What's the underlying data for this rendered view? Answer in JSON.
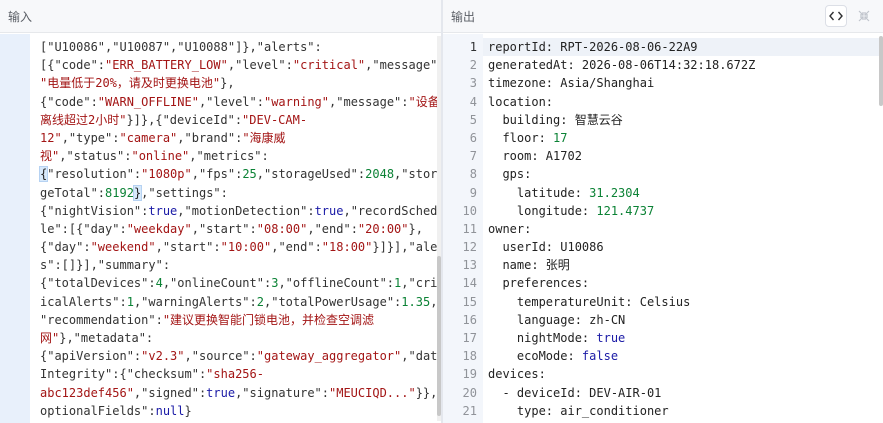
{
  "input_pane": {
    "title": "输入",
    "lines": [
      [
        [
          "p",
          "[\"U10086\",\"U10087\",\"U10088\"]},\"alerts\":"
        ]
      ],
      [
        [
          "p",
          "[{\"code\":"
        ],
        [
          "s",
          "\"ERR_BATTERY_LOW\""
        ],
        [
          "p",
          ",\"level\":"
        ],
        [
          "s",
          "\"critical\""
        ],
        [
          "p",
          ",\"message\":"
        ]
      ],
      [
        [
          "s",
          "\"电量低于20%，请及时更换电池\""
        ],
        [
          "p",
          "},"
        ]
      ],
      [
        [
          "p",
          "{\"code\":"
        ],
        [
          "s",
          "\"WARN_OFFLINE\""
        ],
        [
          "p",
          ",\"level\":"
        ],
        [
          "s",
          "\"warning\""
        ],
        [
          "p",
          ",\"message\":"
        ],
        [
          "s",
          "\"设备"
        ]
      ],
      [
        [
          "s",
          "离线超过2小时\""
        ],
        [
          "p",
          "}]},{\"deviceId\":"
        ],
        [
          "s",
          "\"DEV-CAM-"
        ]
      ],
      [
        [
          "s",
          "12\""
        ],
        [
          "p",
          ",\"type\":"
        ],
        [
          "s",
          "\"camera\""
        ],
        [
          "p",
          ",\"brand\":"
        ],
        [
          "s",
          "\"海康威"
        ]
      ],
      [
        [
          "s",
          "视\""
        ],
        [
          "p",
          ",\"status\":"
        ],
        [
          "s",
          "\"online\""
        ],
        [
          "p",
          ",\"metrics\":"
        ]
      ],
      [
        [
          "br",
          "{"
        ],
        [
          "p",
          "\"resolution\":"
        ],
        [
          "s",
          "\"1080p\""
        ],
        [
          "p",
          ",\"fps\":"
        ],
        [
          "n",
          "25"
        ],
        [
          "p",
          ",\"storageUsed\":"
        ],
        [
          "n",
          "2048"
        ],
        [
          "p",
          ",\"stora"
        ]
      ],
      [
        [
          "p",
          "geTotal\":"
        ],
        [
          "n",
          "8192"
        ],
        [
          "br",
          "}"
        ],
        [
          "p",
          ",\"settings\":"
        ]
      ],
      [
        [
          "p",
          "{\"nightVision\":"
        ],
        [
          "b",
          "true"
        ],
        [
          "p",
          ",\"motionDetection\":"
        ],
        [
          "b",
          "true"
        ],
        [
          "p",
          ",\"recordSchedu"
        ]
      ],
      [
        [
          "p",
          "le\":[{\"day\":"
        ],
        [
          "s",
          "\"weekday\""
        ],
        [
          "p",
          ",\"start\":"
        ],
        [
          "s",
          "\"08:00\""
        ],
        [
          "p",
          ",\"end\":"
        ],
        [
          "s",
          "\"20:00\""
        ],
        [
          "p",
          "},"
        ]
      ],
      [
        [
          "p",
          "{\"day\":"
        ],
        [
          "s",
          "\"weekend\""
        ],
        [
          "p",
          ",\"start\":"
        ],
        [
          "s",
          "\"10:00\""
        ],
        [
          "p",
          ",\"end\":"
        ],
        [
          "s",
          "\"18:00\""
        ],
        [
          "p",
          "}]}],\"alert"
        ]
      ],
      [
        [
          "p",
          "s\":[]}],\"summary\":"
        ]
      ],
      [
        [
          "p",
          "{\"totalDevices\":"
        ],
        [
          "n",
          "4"
        ],
        [
          "p",
          ",\"onlineCount\":"
        ],
        [
          "n",
          "3"
        ],
        [
          "p",
          ",\"offlineCount\":"
        ],
        [
          "n",
          "1"
        ],
        [
          "p",
          ",\"crit"
        ]
      ],
      [
        [
          "p",
          "icalAlerts\":"
        ],
        [
          "n",
          "1"
        ],
        [
          "p",
          ",\"warningAlerts\":"
        ],
        [
          "n",
          "2"
        ],
        [
          "p",
          ",\"totalPowerUsage\":"
        ],
        [
          "n",
          "1.35"
        ],
        [
          "p",
          ","
        ]
      ],
      [
        [
          "p",
          "\"recommendation\":"
        ],
        [
          "s",
          "\"建议更换智能门锁电池，并检查空调滤"
        ]
      ],
      [
        [
          "s",
          "网\""
        ],
        [
          "p",
          "},\"metadata\":"
        ]
      ],
      [
        [
          "p",
          "{\"apiVersion\":"
        ],
        [
          "s",
          "\"v2.3\""
        ],
        [
          "p",
          ",\"source\":"
        ],
        [
          "s",
          "\"gateway_aggregator\""
        ],
        [
          "p",
          ",\"data"
        ]
      ],
      [
        [
          "p",
          "Integrity\":{\"checksum\":"
        ],
        [
          "s",
          "\"sha256-"
        ]
      ],
      [
        [
          "s",
          "abc123def456\""
        ],
        [
          "p",
          ",\"signed\":"
        ],
        [
          "b",
          "true"
        ],
        [
          "p",
          ",\"signature\":"
        ],
        [
          "s",
          "\"MEUCIQD...\""
        ],
        [
          "p",
          "}},\""
        ]
      ],
      [
        [
          "p",
          "optionalFields\":"
        ],
        [
          "b",
          "null"
        ],
        [
          "p",
          "}"
        ]
      ]
    ]
  },
  "output_pane": {
    "title": "输出",
    "line_numbers": [
      "1",
      "2",
      "3",
      "4",
      "5",
      "6",
      "7",
      "8",
      "9",
      "10",
      "11",
      "12",
      "13",
      "14",
      "15",
      "16",
      "17",
      "18",
      "19",
      "20",
      "21"
    ],
    "lines": [
      [
        [
          "yk",
          "reportId: "
        ],
        [
          "yv",
          "RPT-2026-08-06-22A9"
        ]
      ],
      [
        [
          "yk",
          "generatedAt: "
        ],
        [
          "yv",
          "2026-08-06T14:32:18.672Z"
        ]
      ],
      [
        [
          "yk",
          "timezone: "
        ],
        [
          "yv",
          "Asia/Shanghai"
        ]
      ],
      [
        [
          "yk",
          "location:"
        ]
      ],
      [
        [
          "yk",
          "  building: "
        ],
        [
          "yv",
          "智慧云谷"
        ]
      ],
      [
        [
          "yk",
          "  floor: "
        ],
        [
          "ynum",
          "17"
        ]
      ],
      [
        [
          "yk",
          "  room: "
        ],
        [
          "yv",
          "A1702"
        ]
      ],
      [
        [
          "yk",
          "  gps:"
        ]
      ],
      [
        [
          "yk",
          "    latitude: "
        ],
        [
          "ynum",
          "31.2304"
        ]
      ],
      [
        [
          "yk",
          "    longitude: "
        ],
        [
          "ynum",
          "121.4737"
        ]
      ],
      [
        [
          "yk",
          "owner:"
        ]
      ],
      [
        [
          "yk",
          "  userId: "
        ],
        [
          "yv",
          "U10086"
        ]
      ],
      [
        [
          "yk",
          "  name: "
        ],
        [
          "yv",
          "张明"
        ]
      ],
      [
        [
          "yk",
          "  preferences:"
        ]
      ],
      [
        [
          "yk",
          "    temperatureUnit: "
        ],
        [
          "yv",
          "Celsius"
        ]
      ],
      [
        [
          "yk",
          "    language: "
        ],
        [
          "yv",
          "zh-CN"
        ]
      ],
      [
        [
          "yk",
          "    nightMode: "
        ],
        [
          "ybool",
          "true"
        ]
      ],
      [
        [
          "yk",
          "    ecoMode: "
        ],
        [
          "ybool",
          "false"
        ]
      ],
      [
        [
          "yk",
          "devices:"
        ]
      ],
      [
        [
          "yk",
          "  - deviceId: "
        ],
        [
          "yv",
          "DEV-AIR-01"
        ]
      ],
      [
        [
          "yk",
          "    type: "
        ],
        [
          "yv",
          "air_conditioner"
        ]
      ]
    ],
    "toolbar": {
      "code_icon": "code-icon",
      "collapse_icon": "collapse-icon"
    }
  }
}
